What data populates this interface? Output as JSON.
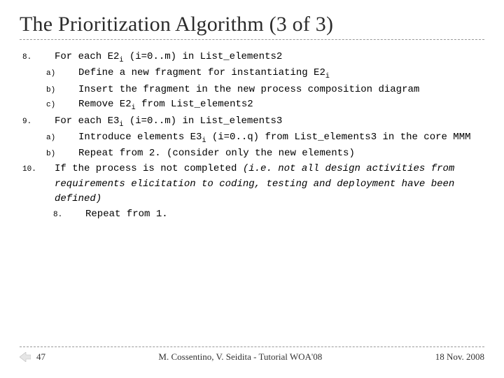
{
  "title": "The Prioritization Algorithm (3 of 3)",
  "items": {
    "n8": "8.",
    "n8_text_a": "For each E2",
    "n8_text_b": " (i=0..m) in List_elements2",
    "n8a": "a)",
    "n8a_text_a": "Define a new fragment for instantiating E2",
    "n8b": "b)",
    "n8b_text": "Insert the fragment in the new process composition diagram",
    "n8c": "c)",
    "n8c_text_a": "Remove E2",
    "n8c_text_b": " from List_elements2",
    "n9": "9.",
    "n9_text_a": "For each E3",
    "n9_text_b": " (i=0..m) in List_elements3",
    "n9a": "a)",
    "n9a_text_a": "Introduce elements E3",
    "n9a_text_b": " (i=0..q) from List_elements3 in the core MMM",
    "n9b": "b)",
    "n9b_text": "Repeat from 2. (consider only the new elements)",
    "n10": "10.",
    "n10_text_a": "If the process is not completed ",
    "n10_text_b": "(i.e. not all design activities from requirements elicitation to coding, testing and deployment have been defined)",
    "n10_8": "8.",
    "n10_8_text": "Repeat from 1."
  },
  "sub_i": "i",
  "footer": {
    "page": "47",
    "center": "M. Cossentino, V. Seidita - Tutorial WOA'08",
    "right": "18 Nov. 2008"
  }
}
